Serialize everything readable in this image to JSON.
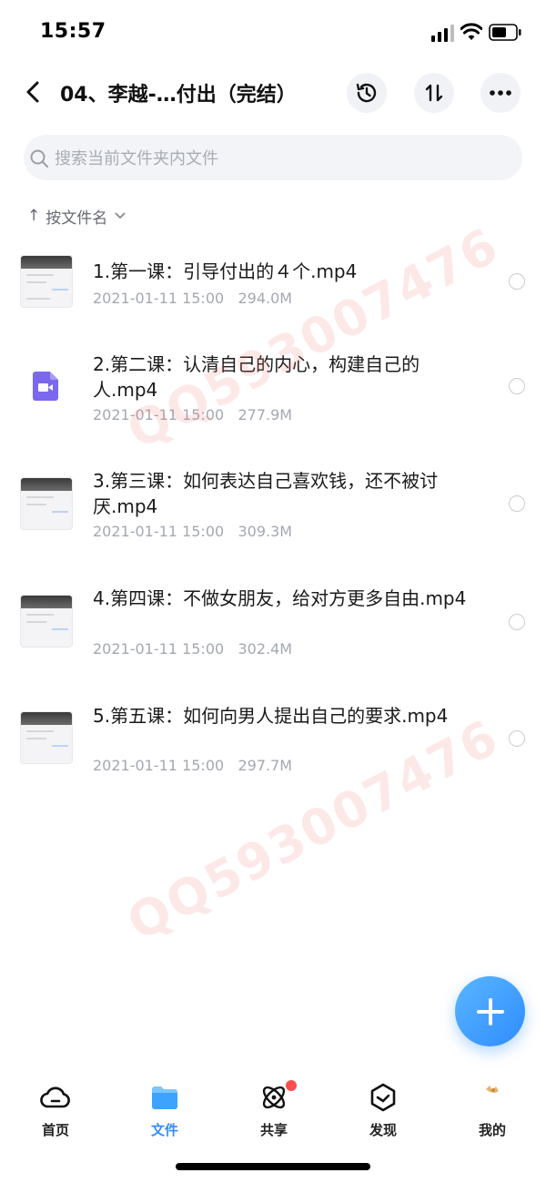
{
  "status_bar": {
    "time": "15:57"
  },
  "header": {
    "title": "04、李越-…付出（完结）"
  },
  "search": {
    "placeholder": "搜索当前文件夹内文件"
  },
  "sort": {
    "label": "按文件名"
  },
  "files": [
    {
      "name": "1.第一课：引导付出的４个.mp4",
      "date": "2021-01-11 15:00",
      "size": "294.0M",
      "thumb": "video-thumbnail"
    },
    {
      "name": "2.第二课：认清自己的内心，构建自己的人.mp4",
      "date": "2021-01-11 15:00",
      "size": "277.9M",
      "thumb": "video-file-icon"
    },
    {
      "name": "3.第三课：如何表达自己喜欢钱，还不被讨厌.mp4",
      "date": "2021-01-11 15:00",
      "size": "309.3M",
      "thumb": "video-thumbnail"
    },
    {
      "name": "4.第四课：不做女朋友，给对方更多自由.mp4",
      "date": "2021-01-11 15:00",
      "size": "302.4M",
      "thumb": "video-thumbnail"
    },
    {
      "name": "5.第五课：如何向男人提出自己的要求.mp4",
      "date": "2021-01-11 15:00",
      "size": "297.7M",
      "thumb": "video-thumbnail"
    }
  ],
  "watermark": {
    "text": "QQ593007476"
  },
  "tabs": [
    {
      "label": "首页",
      "icon": "cloud-icon"
    },
    {
      "label": "文件",
      "icon": "folder-icon",
      "active": true
    },
    {
      "label": "共享",
      "icon": "atom-icon",
      "badge": true
    },
    {
      "label": "发现",
      "icon": "discover-icon"
    },
    {
      "label": "我的",
      "icon": "profile-icon"
    }
  ],
  "colors": {
    "accent": "#2f8cff",
    "badge": "#ff4d4f",
    "video_icon": "#7b68ee"
  }
}
